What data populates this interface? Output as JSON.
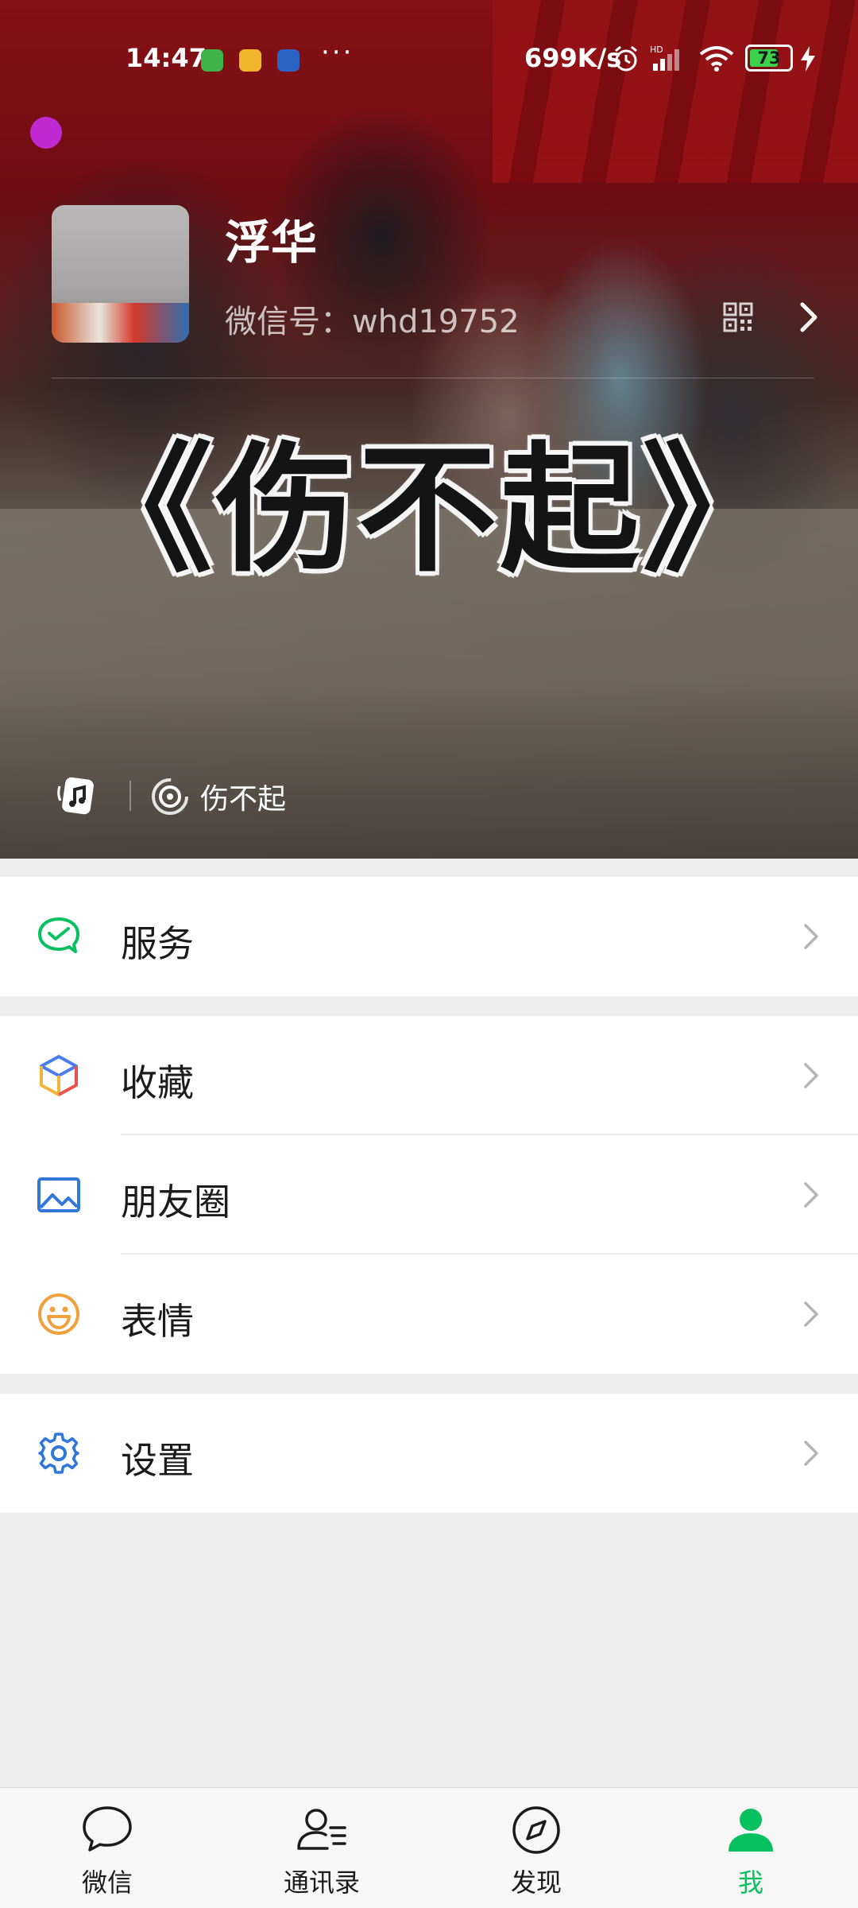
{
  "status_bar": {
    "time": "14:47",
    "network_speed": "699K/s",
    "signal_badge": "HD",
    "battery_level": "73",
    "battery_percent": 73,
    "icons": [
      "android-robot-icon",
      "game-app-icon",
      "panda-app-icon",
      "more-dots-icon",
      "alarm-icon",
      "signal-icon",
      "wifi-icon",
      "battery-icon",
      "charging-icon"
    ],
    "more_dots": "···"
  },
  "profile": {
    "name": "浮华",
    "wechat_id": "微信号：whd19752",
    "cover_caption": "《伤不起》"
  },
  "status_row": {
    "song_title": "伤不起"
  },
  "menu": {
    "groups": [
      {
        "items": [
          {
            "label": "服务",
            "icon": "wallet-icon",
            "color": "#07c160"
          }
        ]
      },
      {
        "items": [
          {
            "label": "收藏",
            "icon": "cube-icon",
            "color": "#4a7cf0"
          },
          {
            "label": "朋友圈",
            "icon": "image-icon",
            "color": "#2f77d9"
          },
          {
            "label": "表情",
            "icon": "smile-icon",
            "color": "#f0a03c"
          }
        ]
      },
      {
        "items": [
          {
            "label": "设置",
            "icon": "gear-icon",
            "color": "#2f77d9"
          }
        ]
      }
    ]
  },
  "tab_bar": {
    "tabs": [
      {
        "label": "微信",
        "icon": "chat-bubble-icon",
        "active": false
      },
      {
        "label": "通讯录",
        "icon": "contacts-icon",
        "active": false
      },
      {
        "label": "发现",
        "icon": "compass-icon",
        "active": false
      },
      {
        "label": "我",
        "icon": "person-icon",
        "active": true
      }
    ],
    "active_color": "#07c160"
  }
}
